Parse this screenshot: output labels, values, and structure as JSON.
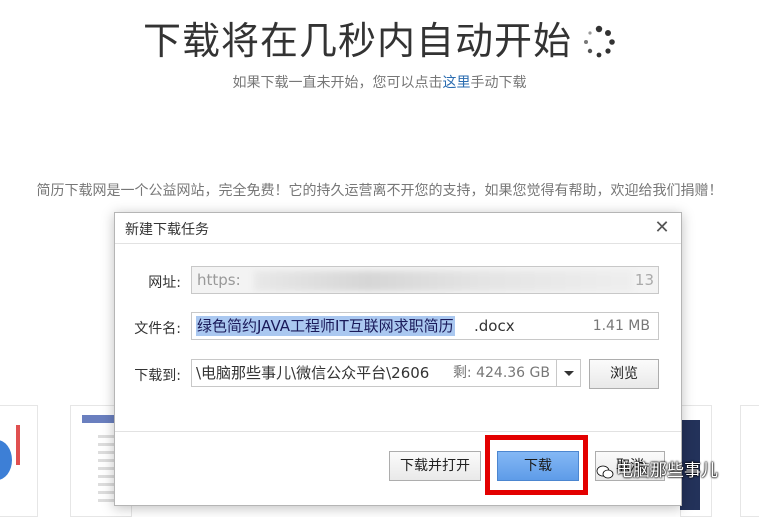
{
  "page": {
    "headline": "下载将在几秒内自动开始",
    "sub_before": "如果下载一直未开始，您可以点击",
    "sub_link": "这里",
    "sub_after": "手动下载",
    "charity_note": "简历下载网是一个公益网站，完全免费！它的持久运营离不开您的支持，如果您觉得有帮助，欢迎给我们捐赠！"
  },
  "dialog": {
    "title": "新建下载任务",
    "url_label": "网址:",
    "url_value_start": "https:",
    "url_value_end": "13",
    "filename_label": "文件名:",
    "filename_selected": "绿色简约JAVA工程师IT互联网求职简历",
    "filename_ext": ".docx",
    "filesize": "1.41 MB",
    "saveto_label": "下载到:",
    "saveto_path": "\\电脑那些事儿\\微信公众平台\\2606",
    "saveto_free": "剩: 424.36 GB",
    "browse_label": "浏览",
    "download_open_label": "下载并打开",
    "download_label": "下载",
    "cancel_label": "取消"
  },
  "watermark": "电脑那些事儿",
  "colors": {
    "highlight_box": "#e30000",
    "primary_button": "#5e9ce8",
    "link": "#2b6cb0",
    "selection": "#aac8f0"
  }
}
